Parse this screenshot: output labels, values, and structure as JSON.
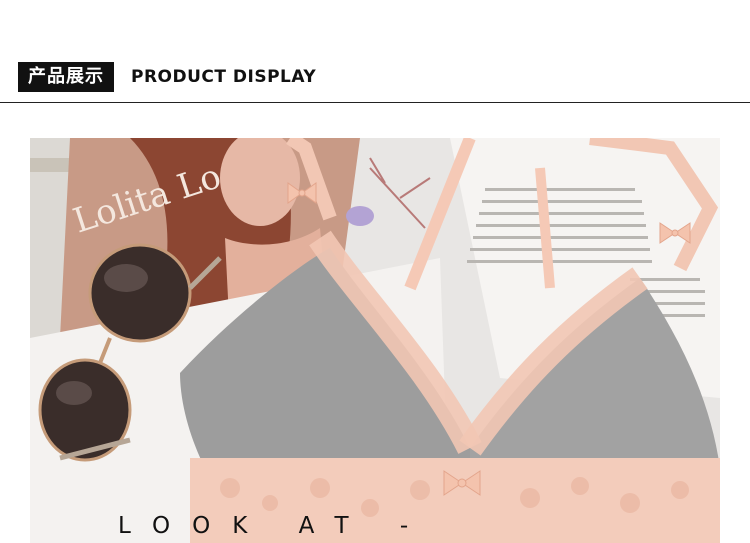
{
  "header": {
    "cn_title": "产品展示",
    "en_title": "PRODUCT DISPLAY"
  },
  "photo": {
    "magazine_text": "Lolita Lo",
    "caption": "LOOK AT -"
  },
  "colors": {
    "lace": "#f2c7b4",
    "fabric": "#9d9d9d",
    "strap": "#f5c9b6",
    "bow": "#f4c3ad",
    "bg_paper": "#f4f2f0"
  },
  "icons": [
    "bow-icon"
  ]
}
